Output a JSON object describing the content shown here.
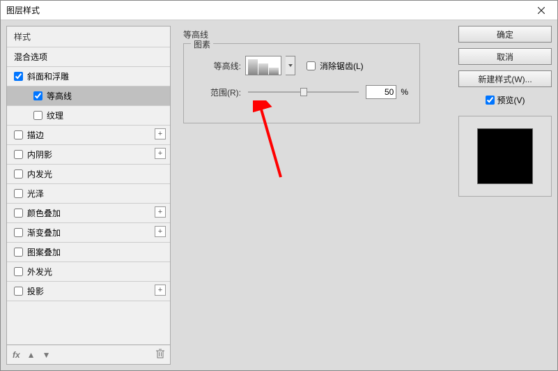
{
  "window": {
    "title": "图层样式"
  },
  "sidebar": {
    "header": "样式",
    "blend": "混合选项",
    "bevel": "斜面和浮雕",
    "contour": "等高线",
    "texture": "纹理",
    "stroke": "描边",
    "innerShadow": "内阴影",
    "innerGlow": "内发光",
    "satin": "光泽",
    "colorOverlay": "颜色叠加",
    "gradientOverlay": "渐变叠加",
    "patternOverlay": "图案叠加",
    "outerGlow": "外发光",
    "dropShadow": "投影",
    "fx": "fx"
  },
  "main": {
    "groupTitle": "等高线",
    "fieldsetLegend": "图素",
    "contourLabel": "等高线:",
    "antialias": "消除锯齿(L)",
    "rangeLabel": "范围(R):",
    "rangeValue": "50",
    "percent": "%"
  },
  "buttons": {
    "ok": "确定",
    "cancel": "取消",
    "newStyle": "新建样式(W)...",
    "preview": "预览(V)"
  }
}
